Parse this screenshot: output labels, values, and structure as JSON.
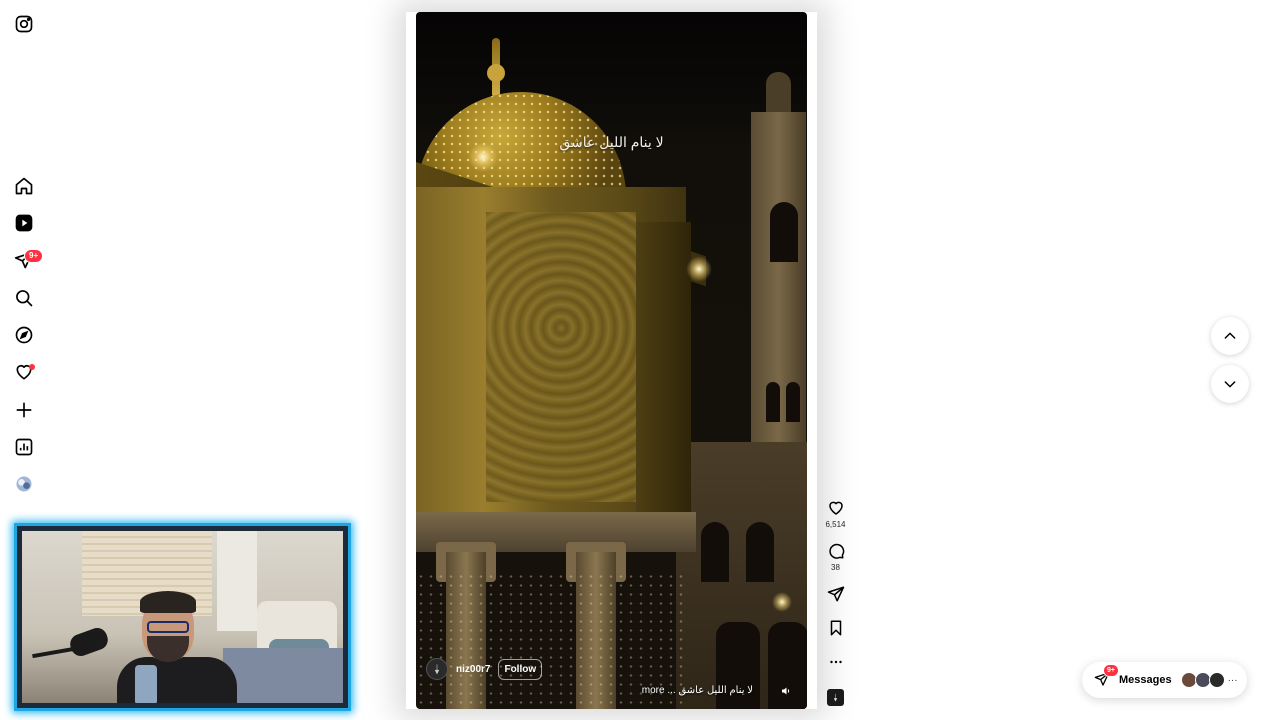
{
  "sidebar": {
    "items": [
      {
        "name": "instagram-logo",
        "label": "Instagram"
      },
      {
        "name": "home",
        "label": "Home"
      },
      {
        "name": "reels",
        "label": "Reels"
      },
      {
        "name": "messages",
        "label": "Messages"
      },
      {
        "name": "search",
        "label": "Search"
      },
      {
        "name": "explore",
        "label": "Explore"
      },
      {
        "name": "notifications",
        "label": "Notifications"
      },
      {
        "name": "create",
        "label": "Create"
      },
      {
        "name": "dashboard",
        "label": "Dashboard"
      },
      {
        "name": "profile",
        "label": "Profile"
      }
    ],
    "messages_badge": "9+"
  },
  "reel": {
    "overlay_text": "لا ينام الليل عاشق",
    "username": "niz00r7",
    "follow_label": "Follow",
    "description": "لا ينام الليل عاشق ... more",
    "likes": "6,514",
    "comments": "38"
  },
  "messages_pill": {
    "label": "Messages",
    "badge": "9+",
    "more": "···"
  },
  "colors": {
    "badge": "#ff3040",
    "webcam_border": "#1fa6e0"
  }
}
